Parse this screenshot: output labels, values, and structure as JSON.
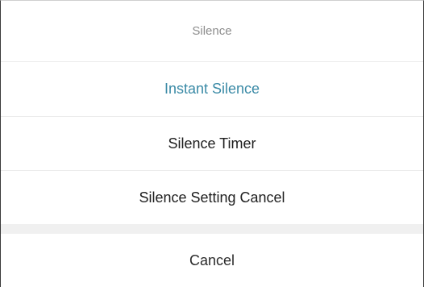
{
  "sheet": {
    "title": "Silence",
    "options": [
      {
        "label": "Instant Silence"
      },
      {
        "label": "Silence Timer"
      },
      {
        "label": "Silence Setting Cancel"
      }
    ],
    "cancel_label": "Cancel"
  },
  "colors": {
    "title_text": "#8c8c8c",
    "highlight_text": "#3a8aa6",
    "option_text": "#1e1e1e",
    "divider": "#ececec",
    "separator_band": "#f0f0f0",
    "background": "#ffffff"
  }
}
